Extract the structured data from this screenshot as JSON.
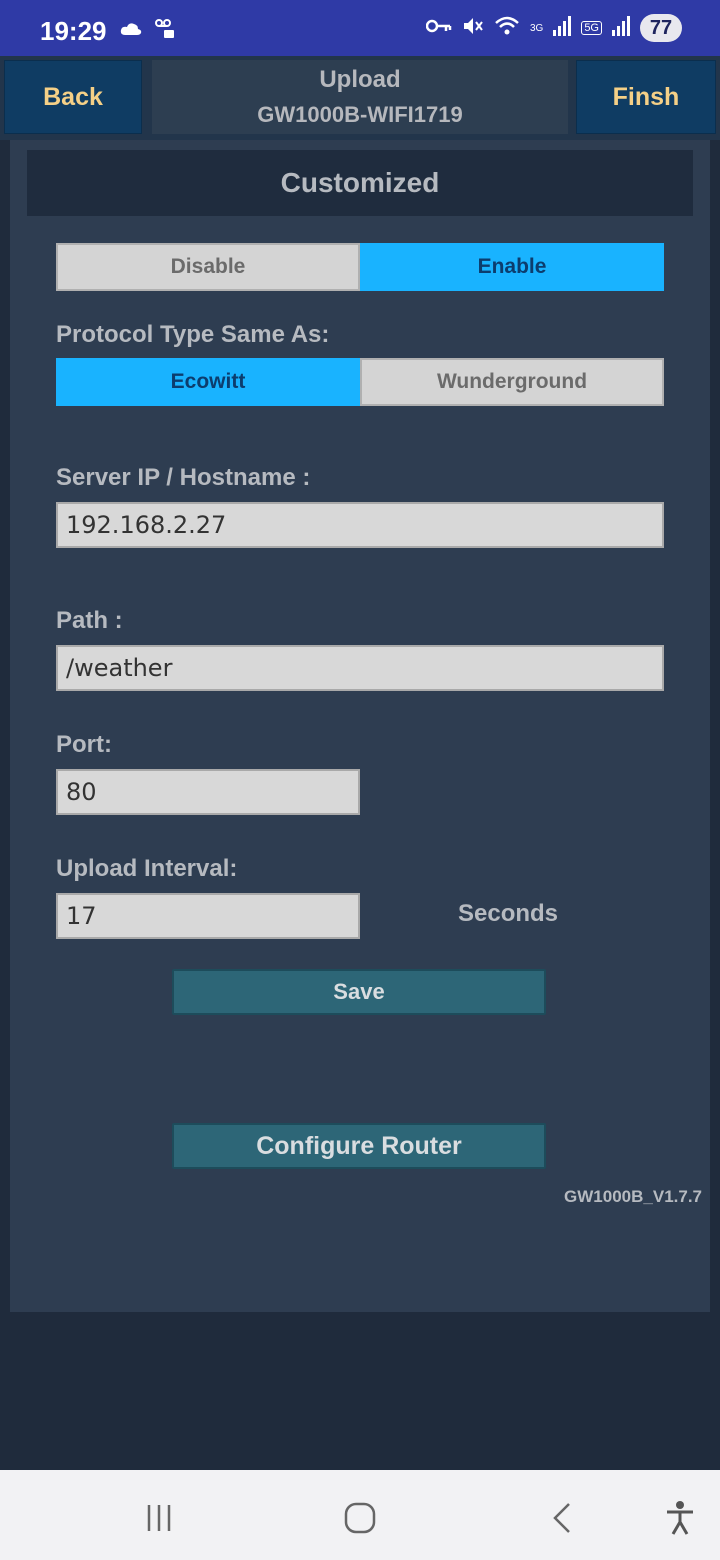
{
  "status_bar": {
    "time": "19:29",
    "network_3g": "3G",
    "network_5g": "5G",
    "battery": "77"
  },
  "header": {
    "back_label": "Back",
    "title": "Upload",
    "device_name": "GW1000B-WIFI1719",
    "finish_label": "Finsh"
  },
  "section": {
    "title": "Customized",
    "toggle": {
      "disable_label": "Disable",
      "enable_label": "Enable",
      "selected": "Enable"
    },
    "protocol_label": "Protocol Type Same As:",
    "protocol": {
      "ecowitt_label": "Ecowitt",
      "wunderground_label": "Wunderground",
      "selected": "Ecowitt"
    },
    "server_label": "Server IP / Hostname :",
    "server_value": "192.168.2.27",
    "path_label": "Path :",
    "path_value": "/weather",
    "port_label": "Port:",
    "port_value": "80",
    "interval_label": "Upload Interval:",
    "interval_value": "17",
    "interval_unit": "Seconds",
    "save_label": "Save",
    "configure_router_label": "Configure Router",
    "version": "GW1000B_V1.7.7"
  },
  "colors": {
    "status_bar": "#2f3aa6",
    "accent_selected": "#19b3ff",
    "header_button_text": "#f5d087",
    "panel": "#2e3d51",
    "action_button": "#2d6677"
  }
}
